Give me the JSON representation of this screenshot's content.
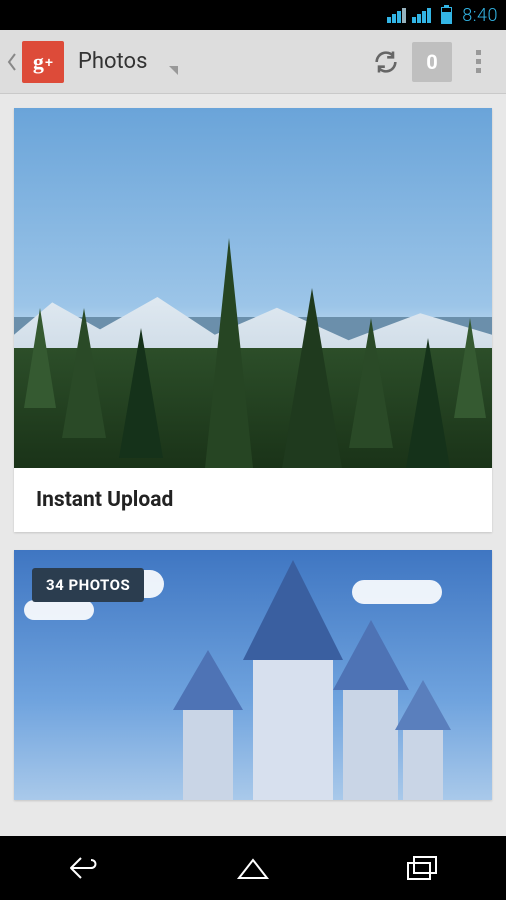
{
  "status": {
    "time": "8:40"
  },
  "actionbar": {
    "logo_text": "g",
    "logo_plus": "+",
    "title": "Photos",
    "notification_count": "0"
  },
  "cards": [
    {
      "label": "Instant Upload"
    },
    {
      "badge": "34 PHOTOS"
    }
  ]
}
